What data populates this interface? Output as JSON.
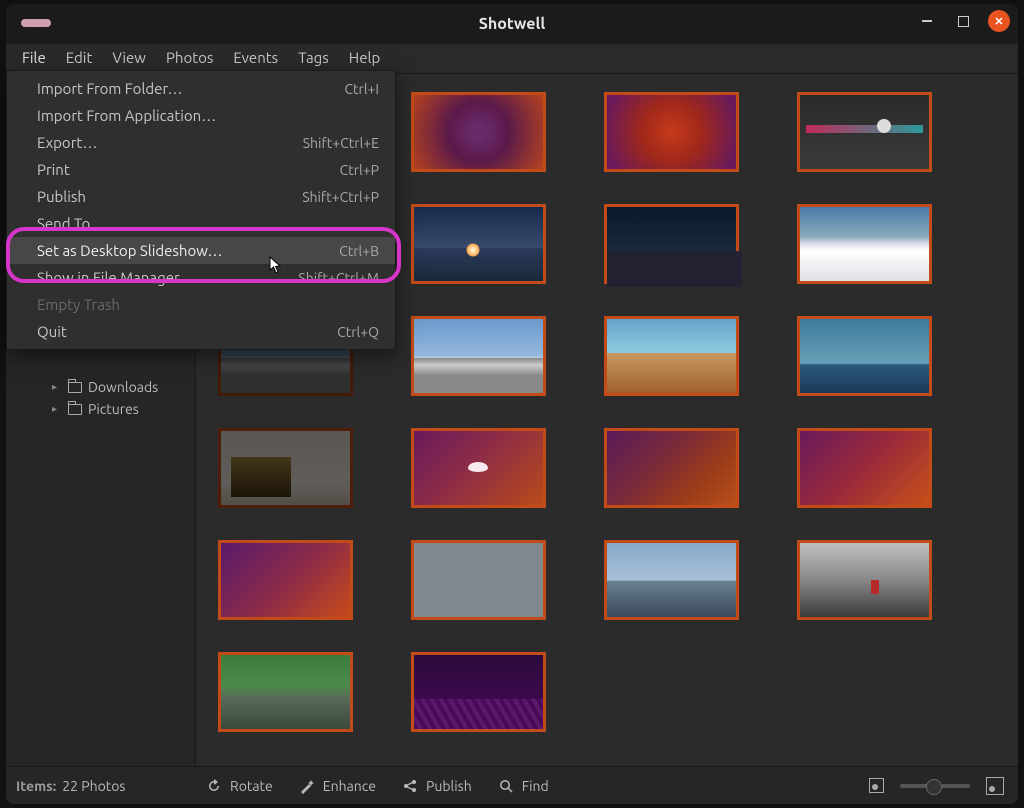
{
  "window": {
    "title": "Shotwell"
  },
  "menubar": [
    "File",
    "Edit",
    "View",
    "Photos",
    "Events",
    "Tags",
    "Help"
  ],
  "menubar_active_index": 0,
  "file_menu": [
    {
      "label": "Import From Folder…",
      "accel": "Ctrl+I",
      "disabled": false
    },
    {
      "label": "Import From Application…",
      "accel": "",
      "disabled": false
    },
    {
      "label": "Export…",
      "accel": "Shift+Ctrl+E",
      "disabled": false
    },
    {
      "label": "Print",
      "accel": "Ctrl+P",
      "disabled": false
    },
    {
      "label": "Publish",
      "accel": "Shift+Ctrl+P",
      "disabled": false
    },
    {
      "label": "Send To…",
      "accel": "",
      "disabled": false
    },
    {
      "label": "Set as Desktop Slideshow…",
      "accel": "Ctrl+B",
      "disabled": false,
      "hover": true
    },
    {
      "label": "Show in File Manager",
      "accel": "Shift+Ctrl+M",
      "disabled": false
    },
    {
      "label": "Empty Trash",
      "accel": "",
      "disabled": true
    },
    {
      "label": "Quit",
      "accel": "Ctrl+Q",
      "disabled": false
    }
  ],
  "sidebar": {
    "items": [
      {
        "label": "Downloads"
      },
      {
        "label": "Pictures"
      }
    ]
  },
  "status": {
    "items_label": "Items:",
    "count_text": "22 Photos"
  },
  "toolbar": {
    "rotate": "Rotate",
    "enhance": "Enhance",
    "publish": "Publish",
    "find": "Find"
  },
  "thumbs": 19
}
